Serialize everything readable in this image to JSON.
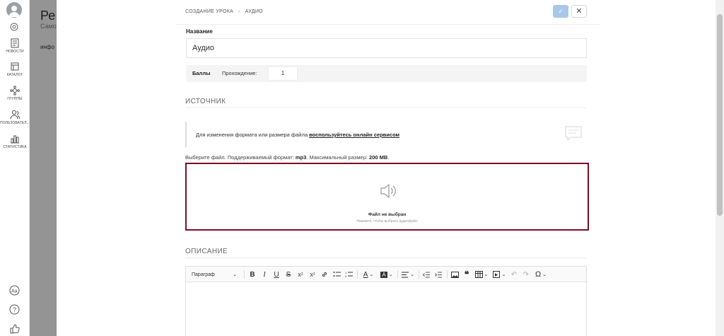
{
  "background_page": {
    "title": "Ре",
    "subtitle": "Само",
    "tab": "инфо"
  },
  "sidebar": {
    "items": [
      {
        "label": "НОВОСТИ",
        "icon": "news-icon"
      },
      {
        "label": "КАТАЛОГ",
        "icon": "catalog-icon"
      },
      {
        "label": "ГРУППЫ",
        "icon": "groups-icon"
      },
      {
        "label": "ПОЛЬЗОВАТЕЛ...",
        "icon": "users-icon"
      },
      {
        "label": "СТАТИСТИКА",
        "icon": "statistics-icon"
      }
    ],
    "bottom_icons": [
      "translate-icon",
      "help-icon",
      "thumbs-up-icon"
    ]
  },
  "header": {
    "breadcrumb": [
      "СОЗДАНИЕ УРОКА",
      "АУДИО"
    ],
    "confirm_symbol": "✓",
    "close_symbol": "✕"
  },
  "form": {
    "name_label": "Название",
    "name_value": "Аудио",
    "scores": {
      "title": "Баллы",
      "pass_label": "Прохождение:",
      "pass_value": "1"
    },
    "source_title": "ИСТОЧНИК",
    "hint_text": "Для изменения формата или размера файла ",
    "hint_link": "воспользуйтесь онлайн сервисом",
    "file_info": {
      "prefix": "Выберите файл. Поддерживаемый формат: ",
      "format": "mp3",
      "middle": ". Максимальный размер: ",
      "max_size": "200 MB",
      "suffix": "."
    },
    "dropzone": {
      "title": "Файл не выбран",
      "subtitle": "Нажмите, чтобы выбрать аудиофайл"
    },
    "description_title": "ОПИСАНИЕ"
  },
  "editor": {
    "paragraph_label": "Параграф"
  },
  "colors": {
    "accent_border": "#7a1023",
    "confirm_button": "#a8c8ea"
  }
}
